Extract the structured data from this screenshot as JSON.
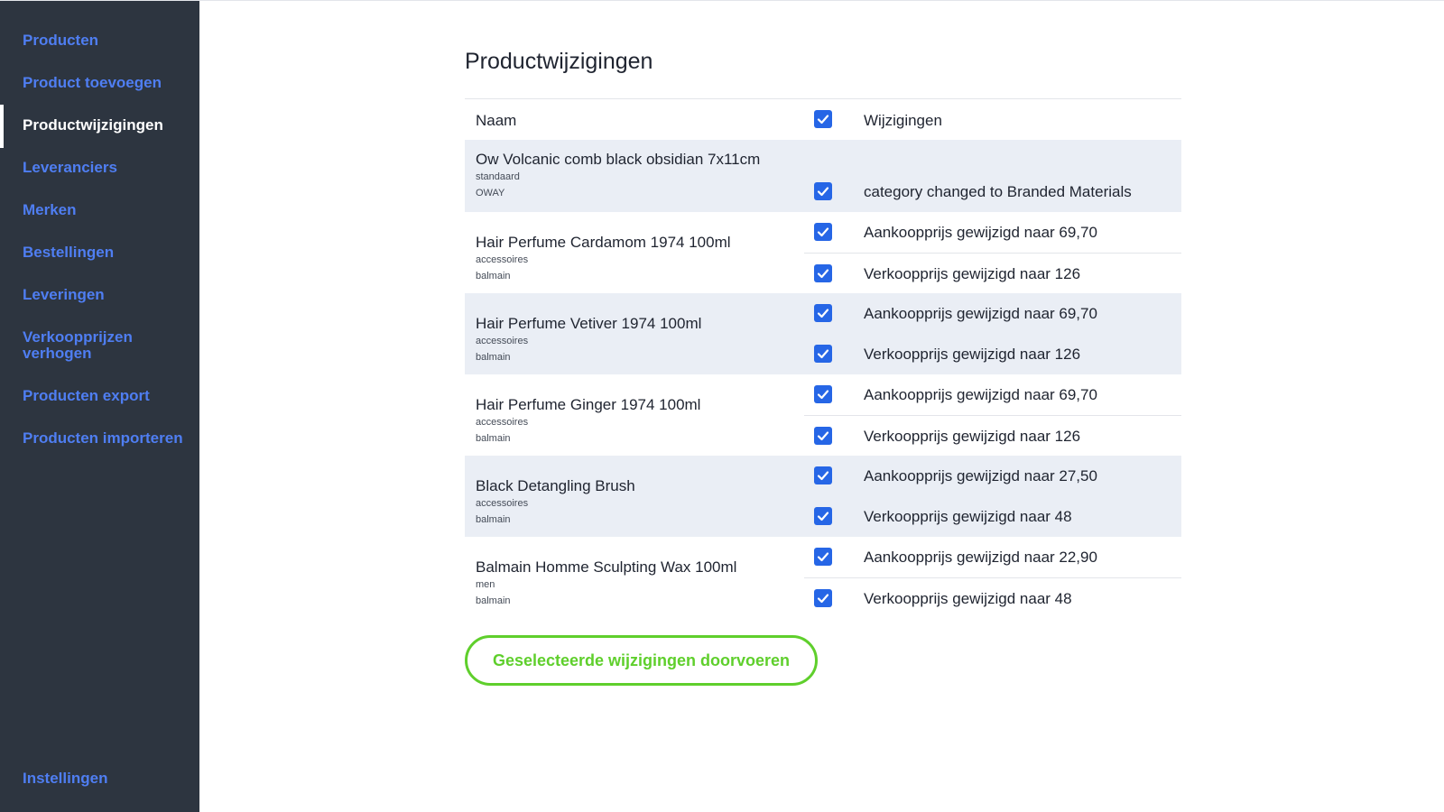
{
  "sidebar": {
    "items": [
      {
        "label": "Producten",
        "active": false
      },
      {
        "label": "Product toevoegen",
        "active": false
      },
      {
        "label": "Productwijzigingen",
        "active": true
      },
      {
        "label": "Leveranciers",
        "active": false
      },
      {
        "label": "Merken",
        "active": false
      },
      {
        "label": "Bestellingen",
        "active": false
      },
      {
        "label": "Leveringen",
        "active": false
      },
      {
        "label": "Verkoopprijzen verhogen",
        "active": false
      },
      {
        "label": "Producten export",
        "active": false
      },
      {
        "label": "Producten importeren",
        "active": false
      }
    ],
    "settings_label": "Instellingen"
  },
  "main": {
    "title": "Productwijzigingen",
    "table": {
      "header": {
        "name": "Naam",
        "changes": "Wijzigingen",
        "select_all_checked": true
      },
      "products": [
        {
          "name": "Ow Volcanic comb black obsidian 7x11cm",
          "category": "standaard",
          "brand": "OWAY",
          "changes": [
            {
              "text": "category changed to Branded Materials",
              "checked": true
            }
          ]
        },
        {
          "name": "Hair Perfume Cardamom 1974 100ml",
          "category": "accessoires",
          "brand": "balmain",
          "changes": [
            {
              "text": "Aankoopprijs gewijzigd naar 69,70",
              "checked": true
            },
            {
              "text": "Verkoopprijs gewijzigd naar 126",
              "checked": true
            }
          ]
        },
        {
          "name": "Hair Perfume Vetiver 1974 100ml",
          "category": "accessoires",
          "brand": "balmain",
          "changes": [
            {
              "text": "Aankoopprijs gewijzigd naar 69,70",
              "checked": true
            },
            {
              "text": "Verkoopprijs gewijzigd naar 126",
              "checked": true
            }
          ]
        },
        {
          "name": "Hair Perfume Ginger 1974 100ml",
          "category": "accessoires",
          "brand": "balmain",
          "changes": [
            {
              "text": "Aankoopprijs gewijzigd naar 69,70",
              "checked": true
            },
            {
              "text": "Verkoopprijs gewijzigd naar 126",
              "checked": true
            }
          ]
        },
        {
          "name": "Black Detangling Brush",
          "category": "accessoires",
          "brand": "balmain",
          "changes": [
            {
              "text": "Aankoopprijs gewijzigd naar 27,50",
              "checked": true
            },
            {
              "text": "Verkoopprijs gewijzigd naar 48",
              "checked": true
            }
          ]
        },
        {
          "name": "Balmain Homme Sculpting Wax 100ml",
          "category": "men",
          "brand": "balmain",
          "changes": [
            {
              "text": "Aankoopprijs gewijzigd naar 22,90",
              "checked": true
            },
            {
              "text": "Verkoopprijs gewijzigd naar 48",
              "checked": true
            }
          ]
        }
      ]
    },
    "apply_button_label": "Geselecteerde wijzigingen doorvoeren"
  },
  "colors": {
    "sidebar_bg": "#2d3540",
    "nav_link": "#4f7ef2",
    "nav_active": "#ffffff",
    "row_shade": "#eaeef5",
    "checkbox": "#2666e6",
    "apply_button": "#5fcf2c"
  },
  "icons": {
    "checkbox": "checkmark-icon"
  }
}
